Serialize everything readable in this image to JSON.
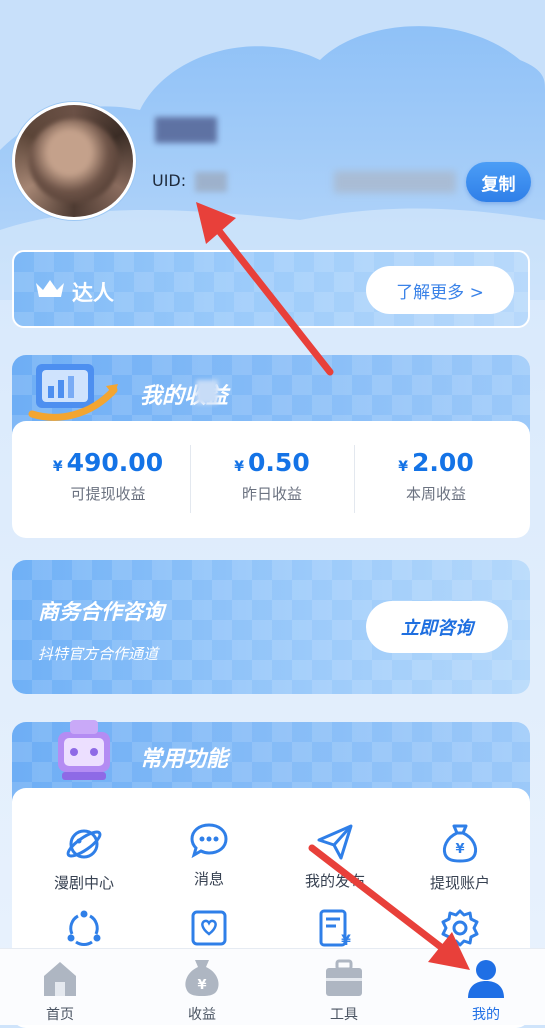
{
  "profile": {
    "uid_label": "UID:",
    "copy_label": "复制"
  },
  "vip_banner": {
    "title": "达人",
    "learn_more": "了解更多 >"
  },
  "earnings": {
    "title": "我的收益",
    "currency": "¥",
    "stats": [
      {
        "value": "490.00",
        "label": "可提现收益"
      },
      {
        "value": "0.50",
        "label": "昨日收益"
      },
      {
        "value": "2.00",
        "label": "本周收益"
      }
    ]
  },
  "business": {
    "title": "商务合作咨询",
    "subtitle": "抖特官方合作通道",
    "button": "立即咨询"
  },
  "functions": {
    "title": "常用功能",
    "items": [
      {
        "label": "漫剧中心",
        "icon": "planet-icon"
      },
      {
        "label": "消息",
        "icon": "chat-bubble-icon"
      },
      {
        "label": "我的发布",
        "icon": "send-icon"
      },
      {
        "label": "提现账户",
        "icon": "money-bag-icon"
      },
      {
        "label": "",
        "icon": "share-icon"
      },
      {
        "label": "",
        "icon": "heart-card-icon"
      },
      {
        "label": "",
        "icon": "invoice-icon"
      },
      {
        "label": "",
        "icon": "settings-icon"
      }
    ]
  },
  "tabbar": {
    "items": [
      {
        "label": "首页",
        "icon": "home-icon"
      },
      {
        "label": "收益",
        "icon": "money-bag-icon"
      },
      {
        "label": "工具",
        "icon": "toolbox-icon"
      },
      {
        "label": "我的",
        "icon": "user-icon",
        "active": true
      }
    ]
  },
  "colors": {
    "primary": "#2f7fe8",
    "value_blue": "#1473e6",
    "arrow_red": "#e8403a"
  }
}
